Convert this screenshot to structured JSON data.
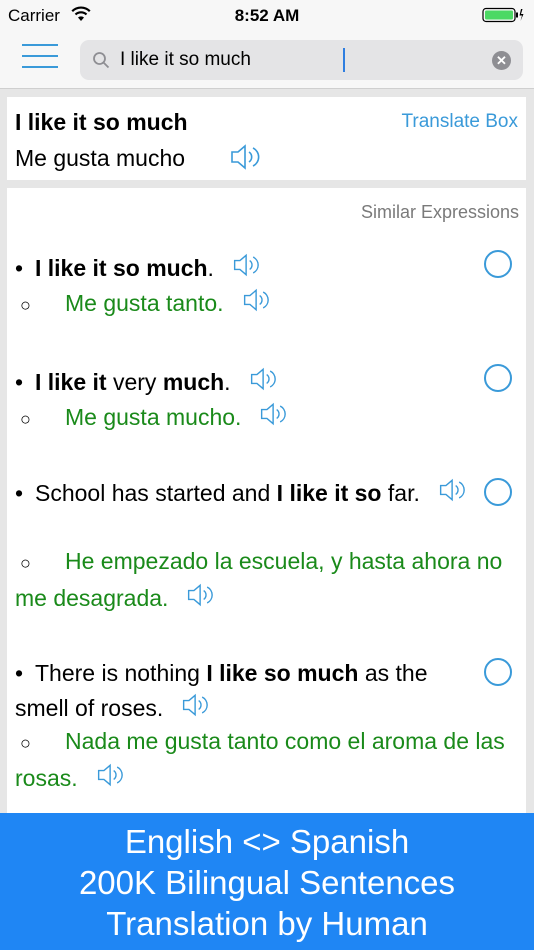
{
  "status": {
    "carrier": "Carrier",
    "time": "8:52 AM"
  },
  "search": {
    "query": "I like it so much"
  },
  "translate": {
    "source": "I like it so much",
    "target": "Me gusta mucho",
    "box_link": "Translate Box"
  },
  "similar": {
    "header": "Similar Expressions",
    "items": [
      {
        "en": [
          {
            "t": "I like it so much",
            "b": true
          },
          {
            "t": ".",
            "b": false
          }
        ],
        "es": "Me gusta tanto."
      },
      {
        "en": [
          {
            "t": "I like it",
            "b": true
          },
          {
            "t": " very ",
            "b": false
          },
          {
            "t": "much",
            "b": true
          },
          {
            "t": ".",
            "b": false
          }
        ],
        "es": "Me gusta mucho."
      },
      {
        "en": [
          {
            "t": "School has started and ",
            "b": false
          },
          {
            "t": "I like it so",
            "b": true
          },
          {
            "t": " far.",
            "b": false
          }
        ],
        "es": "He empezado la escuela, y hasta ahora no me desagrada."
      },
      {
        "en": [
          {
            "t": "There is nothing ",
            "b": false
          },
          {
            "t": "I like so much",
            "b": true
          },
          {
            "t": " as the smell of roses.",
            "b": false
          }
        ],
        "es": "Nada me gusta tanto como el aroma de las rosas."
      }
    ]
  },
  "banner": {
    "line1": "English <> Spanish",
    "line2": "200K Bilingual Sentences",
    "line3": "Translation by Human"
  },
  "colors": {
    "accent": "#3a9ad9",
    "spanish": "#1a8a1a",
    "banner": "#1f86f4"
  }
}
